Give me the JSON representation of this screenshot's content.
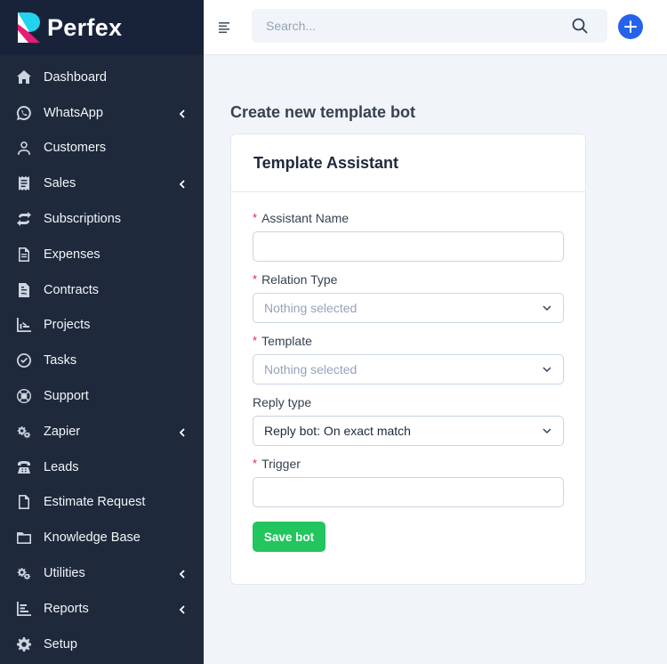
{
  "brand": {
    "name": "Perfex"
  },
  "sidebar": {
    "items": [
      {
        "label": "Dashboard",
        "icon": "home-icon",
        "has_submenu": false
      },
      {
        "label": "WhatsApp",
        "icon": "whatsapp-icon",
        "has_submenu": true
      },
      {
        "label": "Customers",
        "icon": "user-icon",
        "has_submenu": false
      },
      {
        "label": "Sales",
        "icon": "receipt-icon",
        "has_submenu": true
      },
      {
        "label": "Subscriptions",
        "icon": "repeat-icon",
        "has_submenu": false
      },
      {
        "label": "Expenses",
        "icon": "file-text-icon",
        "has_submenu": false
      },
      {
        "label": "Contracts",
        "icon": "contract-icon",
        "has_submenu": false
      },
      {
        "label": "Projects",
        "icon": "chart-icon",
        "has_submenu": false
      },
      {
        "label": "Tasks",
        "icon": "check-circle-icon",
        "has_submenu": false
      },
      {
        "label": "Support",
        "icon": "lifebuoy-icon",
        "has_submenu": false
      },
      {
        "label": "Zapier",
        "icon": "cogs-icon",
        "has_submenu": true
      },
      {
        "label": "Leads",
        "icon": "phone-icon",
        "has_submenu": false
      },
      {
        "label": "Estimate Request",
        "icon": "file-icon",
        "has_submenu": false
      },
      {
        "label": "Knowledge Base",
        "icon": "folder-icon",
        "has_submenu": false
      },
      {
        "label": "Utilities",
        "icon": "cogs-icon",
        "has_submenu": true
      },
      {
        "label": "Reports",
        "icon": "bar-chart-icon",
        "has_submenu": true
      },
      {
        "label": "Setup",
        "icon": "gear-icon",
        "has_submenu": false
      }
    ]
  },
  "topbar": {
    "search_placeholder": "Search..."
  },
  "main": {
    "page_title": "Create new template bot",
    "card_title": "Template Assistant",
    "fields": {
      "assistant_name": {
        "label": "Assistant Name",
        "required": true,
        "value": ""
      },
      "relation_type": {
        "label": "Relation Type",
        "required": true,
        "value": "Nothing selected"
      },
      "template": {
        "label": "Template",
        "required": true,
        "value": "Nothing selected"
      },
      "reply_type": {
        "label": "Reply type",
        "required": false,
        "value": "Reply bot: On exact match"
      },
      "trigger": {
        "label": "Trigger",
        "required": true,
        "value": ""
      }
    },
    "required_mark": "*",
    "save_label": "Save bot"
  },
  "colors": {
    "sidebar_bg": "#1e293b",
    "accent": "#2563eb",
    "save": "#22c55e",
    "required": "#e11d48"
  }
}
